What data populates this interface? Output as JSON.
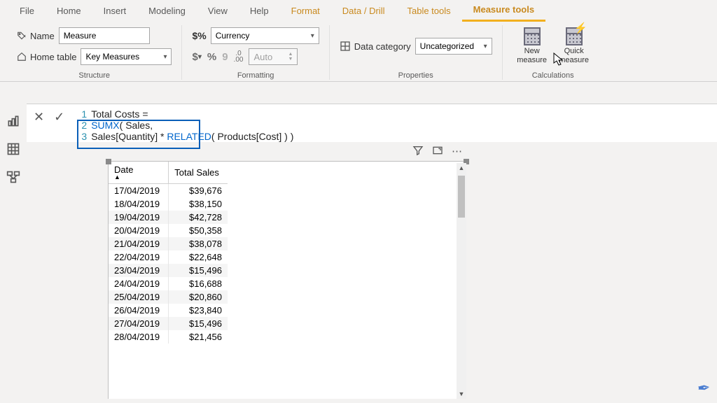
{
  "tabs": {
    "items": [
      "File",
      "Home",
      "Insert",
      "Modeling",
      "View",
      "Help",
      "Format",
      "Data / Drill",
      "Table tools",
      "Measure tools"
    ],
    "ctx_start": 6,
    "active": 9
  },
  "ribbon": {
    "structure": {
      "label": "Structure",
      "name_label": "Name",
      "name_value": "Measure",
      "home_label": "Home table",
      "home_value": "Key Measures"
    },
    "formatting": {
      "label": "Formatting",
      "format_value": "Currency",
      "auto_label": "Auto",
      "dollar": "$",
      "percent": "%",
      "comma": "9",
      "dec": ".00",
      "dec_arrow": "→0"
    },
    "properties": {
      "label": "Properties",
      "cat_label": "Data category",
      "cat_value": "Uncategorized"
    },
    "calculations": {
      "label": "Calculations",
      "new_measure": "New measure",
      "quick_measure": "Quick measure"
    }
  },
  "formula": {
    "lines": [
      {
        "n": "1",
        "parts": [
          {
            "t": "Total Costs = ",
            "c": "tx"
          }
        ]
      },
      {
        "n": "2",
        "parts": [
          {
            "t": "SUMX",
            "c": "kw"
          },
          {
            "t": "( Sales,",
            "c": "tx"
          }
        ]
      },
      {
        "n": "3",
        "parts": [
          {
            "t": "    Sales[Quantity]",
            "c": "tx"
          },
          {
            "t": " * ",
            "c": "tx"
          },
          {
            "t": "RELATED",
            "c": "kw"
          },
          {
            "t": "( Products[Cost] ) )",
            "c": "tx"
          }
        ]
      }
    ]
  },
  "table": {
    "columns": [
      "Date",
      "Total Sales"
    ],
    "rows": [
      [
        "17/04/2019",
        "$39,676"
      ],
      [
        "18/04/2019",
        "$38,150"
      ],
      [
        "19/04/2019",
        "$42,728"
      ],
      [
        "20/04/2019",
        "$50,358"
      ],
      [
        "21/04/2019",
        "$38,078"
      ],
      [
        "22/04/2019",
        "$22,648"
      ],
      [
        "23/04/2019",
        "$15,496"
      ],
      [
        "24/04/2019",
        "$16,688"
      ],
      [
        "25/04/2019",
        "$20,860"
      ],
      [
        "26/04/2019",
        "$23,840"
      ],
      [
        "27/04/2019",
        "$15,496"
      ],
      [
        "28/04/2019",
        "$21,456"
      ]
    ]
  }
}
